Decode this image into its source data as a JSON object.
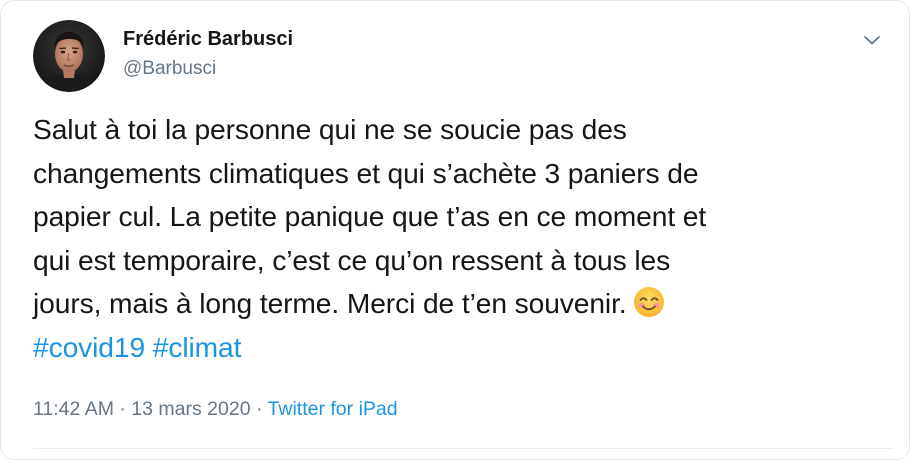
{
  "author": {
    "name": "Frédéric Barbusci",
    "handle": "@Barbusci"
  },
  "tweet": {
    "lines": [
      "Salut à toi la personne qui ne se soucie pas des",
      "changements climatiques et qui s’achète 3 paniers de",
      "papier cul. La petite panique que t’as en ce moment et",
      "qui est temporaire, c’est ce qu’on ressent à tous les",
      "jours, mais à long terme. Merci de t’en souvenir."
    ],
    "emoji": "smiling-face-with-smiling-eyes",
    "hashtags": [
      "#covid19",
      "#climat"
    ]
  },
  "meta": {
    "time": "11:42 AM",
    "separator_1": "·",
    "date": "13 mars 2020",
    "separator_2": "·",
    "source": "Twitter for iPad"
  },
  "colors": {
    "text": "#14171a",
    "secondary": "#657786",
    "link": "#1b95e0",
    "border": "#e1e8ed"
  },
  "icons": {
    "menu": "chevron-down-icon"
  }
}
